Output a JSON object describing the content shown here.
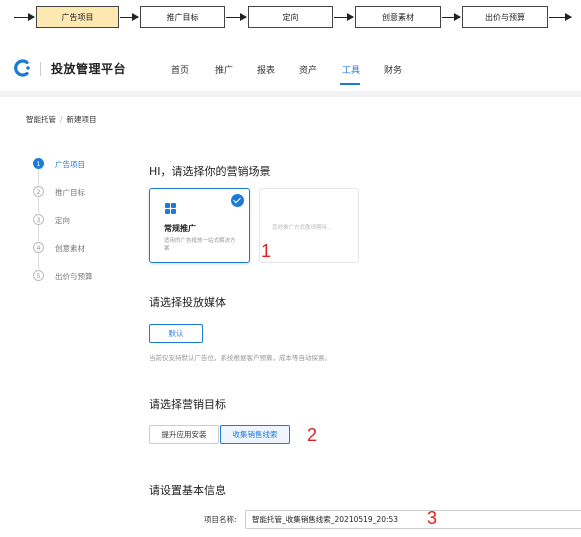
{
  "flow": {
    "steps": [
      "广告项目",
      "推广目标",
      "定向",
      "创意素材",
      "出价与预算"
    ],
    "active_color": "#fce8b0"
  },
  "header": {
    "brand": "投放管理平台",
    "nav": [
      "首页",
      "推广",
      "报表",
      "资产",
      "工具",
      "财务"
    ],
    "active_nav": "工具",
    "accent": "#1d7bd8"
  },
  "breadcrumb": [
    "智能托管",
    "新建项目"
  ],
  "steps": [
    {
      "num": "1",
      "label": "广告项目",
      "active": true
    },
    {
      "num": "2",
      "label": "推广目标",
      "active": false
    },
    {
      "num": "3",
      "label": "定向",
      "active": false
    },
    {
      "num": "4",
      "label": "创意素材",
      "active": false
    },
    {
      "num": "5",
      "label": "出价与预算",
      "active": false
    }
  ],
  "scene": {
    "title": "HI，请选择你的营销场景",
    "selected_card": {
      "icon": "grid-icon",
      "title": "常规推广",
      "desc": "适用的广告投放一站式解决方案"
    },
    "disabled_card": {
      "text": "其他推广方式敬请期待..."
    }
  },
  "media": {
    "title": "请选择投放媒体",
    "option": "默认",
    "hint": "当前仅支持默认广告位，系统根据客户预算，成本等自动探索。"
  },
  "goal": {
    "title": "请选择营销目标",
    "options": [
      "提升应用安装",
      "收集销售线索"
    ],
    "selected": "收集销售线索"
  },
  "basic": {
    "title": "请设置基本信息",
    "name_label": "项目名称:",
    "name_value": "智能托管_收集销售线索_20210519_20:53"
  },
  "annotations": {
    "n1": "1",
    "n2": "2",
    "n3": "3",
    "color": "#e02020"
  }
}
